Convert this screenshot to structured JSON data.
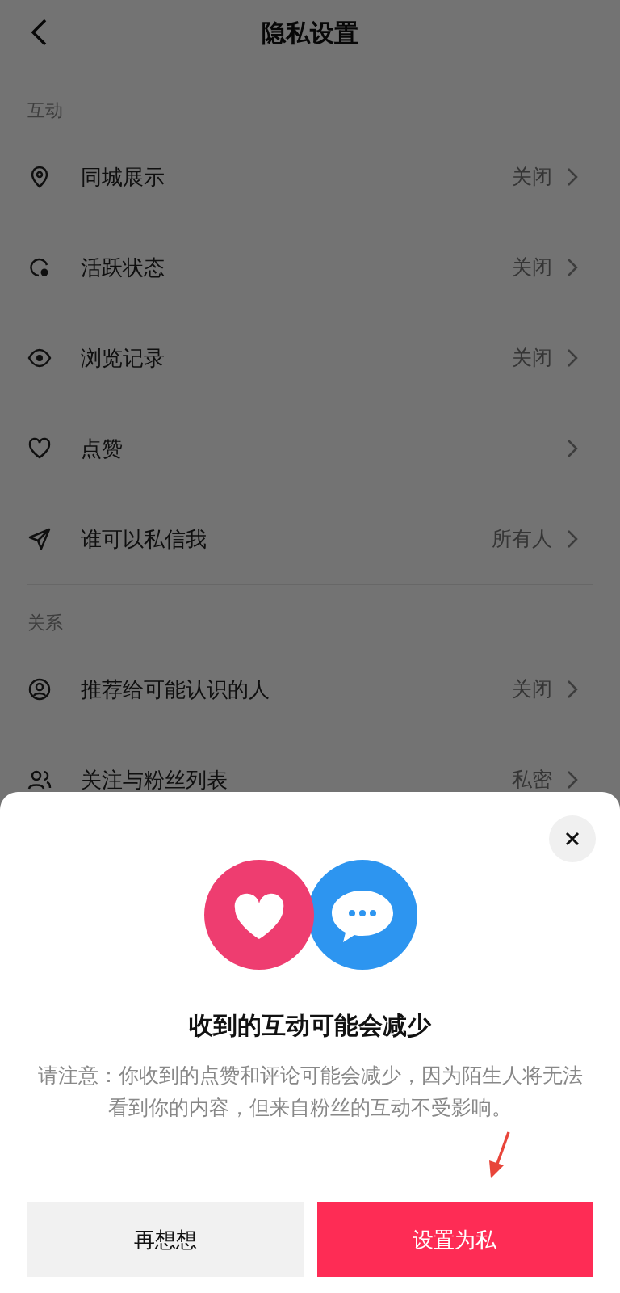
{
  "header": {
    "title": "隐私设置"
  },
  "sections": [
    {
      "label": "互动",
      "rows": [
        {
          "kind": "pin",
          "label": "同城展示",
          "value": "关闭"
        },
        {
          "kind": "status",
          "label": "活跃状态",
          "value": "关闭"
        },
        {
          "kind": "eye",
          "label": "浏览记录",
          "value": "关闭"
        },
        {
          "kind": "heart",
          "label": "点赞"
        },
        {
          "kind": "send",
          "label": "谁可以私信我",
          "value": "所有人"
        }
      ]
    },
    {
      "label": "关系",
      "rows": [
        {
          "kind": "person",
          "label": "推荐给可能认识的人",
          "value": "关闭"
        },
        {
          "kind": "people",
          "label": "关注与粉丝列表",
          "value": "私密"
        }
      ]
    }
  ],
  "sheet": {
    "title": "收到的互动可能会减少",
    "message": "请注意：你收到的点赞和评论可能会减少，因为陌生人将无法看到你的内容，但来自粉丝的互动不受影响。",
    "buttons": [
      {
        "kind": "secondary",
        "label": "再想想"
      },
      {
        "kind": "primary",
        "label": "设置为私"
      }
    ]
  }
}
